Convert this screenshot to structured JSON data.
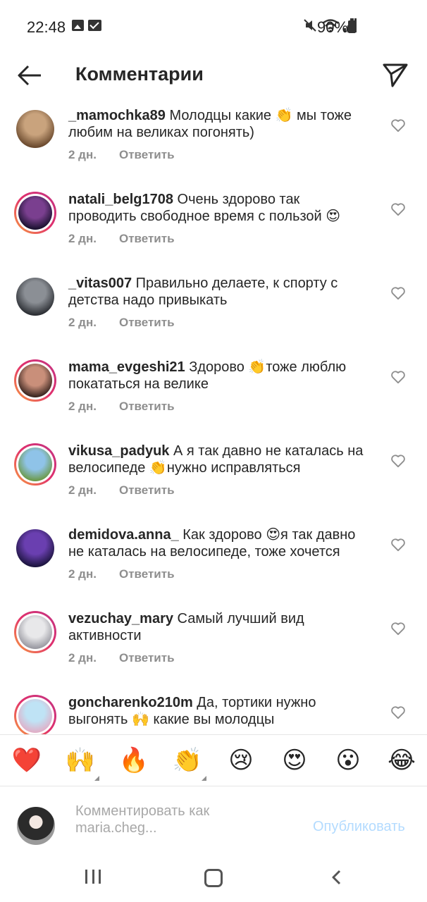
{
  "status": {
    "time": "22:48",
    "battery": "90%"
  },
  "header": {
    "title": "Комментарии"
  },
  "comments": [
    {
      "user": "_mamochka89",
      "text": "Молодцы какие 👏 мы тоже любим на великах погонять)",
      "age": "2 дн.",
      "reply": "Ответить",
      "story": false,
      "avatar_colors": [
        "#c9a37d",
        "#6b4a2e"
      ]
    },
    {
      "user": "natali_belg1708",
      "text": "Очень здорово так проводить свободное время с пользой 😍",
      "age": "2 дн.",
      "reply": "Ответить",
      "story": true,
      "avatar_colors": [
        "#7a3f8f",
        "#1b1230"
      ]
    },
    {
      "user": "_vitas007",
      "text": "Правильно делаете, к спорту с детства надо привыкать",
      "age": "2 дн.",
      "reply": "Ответить",
      "story": false,
      "avatar_colors": [
        "#8b8f95",
        "#2c2f34"
      ]
    },
    {
      "user": "mama_evgeshi21",
      "text": "Здорово 👏тоже люблю покататься на велике",
      "age": "2 дн.",
      "reply": "Ответить",
      "story": true,
      "avatar_colors": [
        "#c98f7a",
        "#3b2620"
      ]
    },
    {
      "user": "vikusa_padyuk",
      "text": "А я так давно не каталась на велосипеде 👏нужно исправляться",
      "age": "2 дн.",
      "reply": "Ответить",
      "story": true,
      "avatar_colors": [
        "#8fc3e8",
        "#6c9a4a"
      ]
    },
    {
      "user": "demidova.anna_",
      "text": "Как здорово 😍я так давно не каталась на велосипеде, тоже хочется",
      "age": "2 дн.",
      "reply": "Ответить",
      "story": false,
      "avatar_colors": [
        "#6a3fb0",
        "#1d1540"
      ]
    },
    {
      "user": "vezuchay_mary",
      "text": "Самый лучший вид активности",
      "age": "2 дн.",
      "reply": "Ответить",
      "story": true,
      "avatar_colors": [
        "#e8e8ea",
        "#9a9aa2"
      ]
    },
    {
      "user": "goncharenko210m",
      "text": "Да, тортики нужно выгонять 🙌 какие вы молодцы",
      "age": "2 дн.",
      "reply": "Ответить",
      "story": true,
      "avatar_colors": [
        "#bfe3f5",
        "#e0b0c8"
      ]
    }
  ],
  "emoji_bar": [
    {
      "glyph": "❤️",
      "name": "heart-emoji-button",
      "variants": false
    },
    {
      "glyph": "🙌",
      "name": "raised-hands-emoji-button",
      "variants": true
    },
    {
      "glyph": "🔥",
      "name": "fire-emoji-button",
      "variants": false
    },
    {
      "glyph": "👏",
      "name": "clapping-hands-emoji-button",
      "variants": true
    },
    {
      "glyph": "😢",
      "name": "crying-face-emoji-button",
      "variants": false
    },
    {
      "glyph": "😍",
      "name": "heart-eyes-emoji-button",
      "variants": false
    },
    {
      "glyph": "😮",
      "name": "surprised-face-emoji-button",
      "variants": false
    },
    {
      "glyph": "😂",
      "name": "tears-of-joy-emoji-button",
      "variants": false
    }
  ],
  "composer": {
    "placeholder": "Комментировать как maria.cheg...",
    "publish_label": "Опубликовать"
  },
  "colors": {
    "link_disabled": "#b3dbff",
    "meta_text": "#8e8e8e",
    "story_ring": "#e1306c"
  },
  "icons": {
    "back": "back-arrow-icon",
    "send": "paper-plane-icon",
    "like": "heart-outline-icon"
  }
}
